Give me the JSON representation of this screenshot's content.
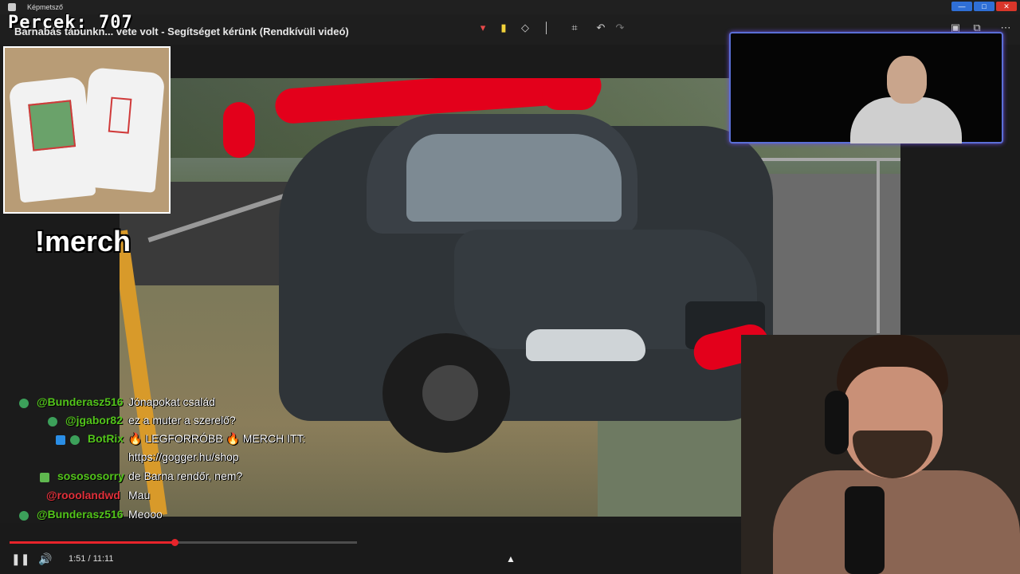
{
  "window": {
    "app_title": "Képmetsző",
    "controls": {
      "minimize": "—",
      "maximize": "□",
      "close": "✕"
    }
  },
  "toolbar": {
    "video_title": "Barnabás tábunkn... vete volt - Segítséget kérünk (Rendkívüli videó)",
    "tools": [
      {
        "name": "select-tool-icon",
        "glyph": "▾"
      },
      {
        "name": "highlighter-icon",
        "glyph": "▮"
      },
      {
        "name": "eraser-icon",
        "glyph": "◇"
      },
      {
        "name": "pen-icon",
        "glyph": "│"
      },
      {
        "name": "crop-icon",
        "glyph": "⌗"
      },
      {
        "name": "undo-icon",
        "glyph": "↶"
      },
      {
        "name": "redo-icon",
        "glyph": "↷"
      }
    ],
    "right_tools": [
      {
        "name": "save-icon",
        "glyph": "▣"
      },
      {
        "name": "copy-icon",
        "glyph": "⧉"
      },
      {
        "name": "more-icon",
        "glyph": "⋯"
      }
    ]
  },
  "overlay": {
    "percek": "Percek: 707",
    "merch": "!merch"
  },
  "chat": [
    {
      "user": "@Bunderasz516",
      "user_color": "#52c41a",
      "message": "Jónapokat család",
      "badge_color": "#3ca05a"
    },
    {
      "user": "@jgabor82",
      "user_color": "#52c41a",
      "message": "ez a muter a szerelő?",
      "badge_color": "#3ca05a"
    },
    {
      "user": "BotRix",
      "user_color": "#52c41a",
      "message": "🔥 LEGFORRÓBB 🔥 MERCH ITT:",
      "badge_color": "#2a8ee6"
    },
    {
      "user": "",
      "user_color": "#52c41a",
      "message": "https://gogger.hu/shop",
      "badge_color": ""
    },
    {
      "user": "sosososorry",
      "user_color": "#52c41a",
      "message": "de Barna rendőr, nem?",
      "badge_color": "#5fb84f"
    },
    {
      "user": "@rooolandwd",
      "user_color": "#e0303a",
      "message": "Mau",
      "badge_color": ""
    },
    {
      "user": "@Bunderasz516",
      "user_color": "#52c41a",
      "message": "Meooo",
      "badge_color": "#3ca05a"
    }
  ],
  "player": {
    "time": "1:51 / 11:11",
    "progress_fraction": 0.475,
    "play_pause_icon": "pause-icon",
    "volume_icon": "volume-icon"
  },
  "colors": {
    "accent": "#e8242b",
    "webcam_border": "#5a6fd6",
    "redaction": "#e3001b"
  }
}
